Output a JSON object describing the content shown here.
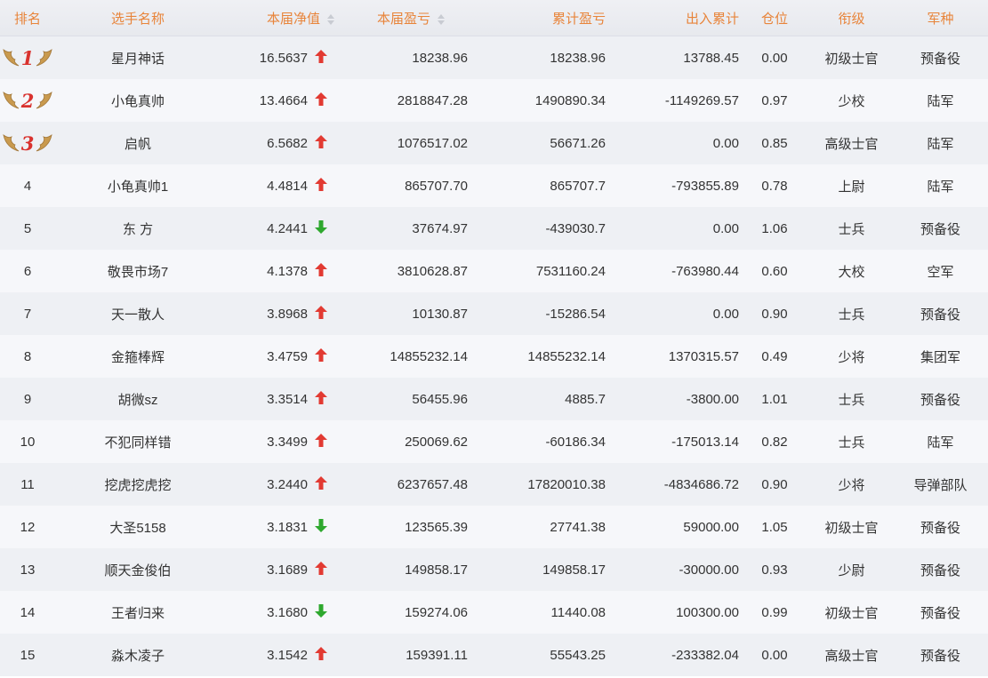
{
  "columns": {
    "rank": "排名",
    "name": "选手名称",
    "nav": "本届净值",
    "current_pnl": "本届盈亏",
    "total_pnl": "累计盈亏",
    "flow": "出入累计",
    "position": "仓位",
    "title": "衔级",
    "branch": "军种"
  },
  "colors": {
    "header_text": "#e8843a",
    "up": "#e23a32",
    "down": "#2ea82e",
    "medal": "#d9322e",
    "wing": "#c99a4e"
  },
  "rows": [
    {
      "rank": "1",
      "name": "星月神话",
      "nav": "16.5637",
      "trend": "up",
      "current_pnl": "18238.96",
      "total_pnl": "18238.96",
      "flow": "13788.45",
      "position": "0.00",
      "title": "初级士官",
      "branch": "预备役"
    },
    {
      "rank": "2",
      "name": "小龟真帅",
      "nav": "13.4664",
      "trend": "up",
      "current_pnl": "2818847.28",
      "total_pnl": "1490890.34",
      "flow": "-1149269.57",
      "position": "0.97",
      "title": "少校",
      "branch": "陆军"
    },
    {
      "rank": "3",
      "name": "启帆",
      "nav": "6.5682",
      "trend": "up",
      "current_pnl": "1076517.02",
      "total_pnl": "56671.26",
      "flow": "0.00",
      "position": "0.85",
      "title": "高级士官",
      "branch": "陆军"
    },
    {
      "rank": "4",
      "name": "小龟真帅1",
      "nav": "4.4814",
      "trend": "up",
      "current_pnl": "865707.70",
      "total_pnl": "865707.7",
      "flow": "-793855.89",
      "position": "0.78",
      "title": "上尉",
      "branch": "陆军"
    },
    {
      "rank": "5",
      "name": "东 方",
      "nav": "4.2441",
      "trend": "down",
      "current_pnl": "37674.97",
      "total_pnl": "-439030.7",
      "flow": "0.00",
      "position": "1.06",
      "title": "士兵",
      "branch": "预备役"
    },
    {
      "rank": "6",
      "name": "敬畏市场7",
      "nav": "4.1378",
      "trend": "up",
      "current_pnl": "3810628.87",
      "total_pnl": "7531160.24",
      "flow": "-763980.44",
      "position": "0.60",
      "title": "大校",
      "branch": "空军"
    },
    {
      "rank": "7",
      "name": "天一散人",
      "nav": "3.8968",
      "trend": "up",
      "current_pnl": "10130.87",
      "total_pnl": "-15286.54",
      "flow": "0.00",
      "position": "0.90",
      "title": "士兵",
      "branch": "预备役"
    },
    {
      "rank": "8",
      "name": "金箍棒辉",
      "nav": "3.4759",
      "trend": "up",
      "current_pnl": "14855232.14",
      "total_pnl": "14855232.14",
      "flow": "1370315.57",
      "position": "0.49",
      "title": "少将",
      "branch": "集团军"
    },
    {
      "rank": "9",
      "name": "胡微sz",
      "nav": "3.3514",
      "trend": "up",
      "current_pnl": "56455.96",
      "total_pnl": "4885.7",
      "flow": "-3800.00",
      "position": "1.01",
      "title": "士兵",
      "branch": "预备役"
    },
    {
      "rank": "10",
      "name": "不犯同样错",
      "nav": "3.3499",
      "trend": "up",
      "current_pnl": "250069.62",
      "total_pnl": "-60186.34",
      "flow": "-175013.14",
      "position": "0.82",
      "title": "士兵",
      "branch": "陆军"
    },
    {
      "rank": "11",
      "name": "挖虎挖虎挖",
      "nav": "3.2440",
      "trend": "up",
      "current_pnl": "6237657.48",
      "total_pnl": "17820010.38",
      "flow": "-4834686.72",
      "position": "0.90",
      "title": "少将",
      "branch": "导弹部队"
    },
    {
      "rank": "12",
      "name": "大圣5158",
      "nav": "3.1831",
      "trend": "down",
      "current_pnl": "123565.39",
      "total_pnl": "27741.38",
      "flow": "59000.00",
      "position": "1.05",
      "title": "初级士官",
      "branch": "预备役"
    },
    {
      "rank": "13",
      "name": "顺天金俊伯",
      "nav": "3.1689",
      "trend": "up",
      "current_pnl": "149858.17",
      "total_pnl": "149858.17",
      "flow": "-30000.00",
      "position": "0.93",
      "title": "少尉",
      "branch": "预备役"
    },
    {
      "rank": "14",
      "name": "王者归来",
      "nav": "3.1680",
      "trend": "down",
      "current_pnl": "159274.06",
      "total_pnl": "11440.08",
      "flow": "100300.00",
      "position": "0.99",
      "title": "初级士官",
      "branch": "预备役"
    },
    {
      "rank": "15",
      "name": "淼木凌子",
      "nav": "3.1542",
      "trend": "up",
      "current_pnl": "159391.11",
      "total_pnl": "55543.25",
      "flow": "-233382.04",
      "position": "0.00",
      "title": "高级士官",
      "branch": "预备役"
    }
  ]
}
